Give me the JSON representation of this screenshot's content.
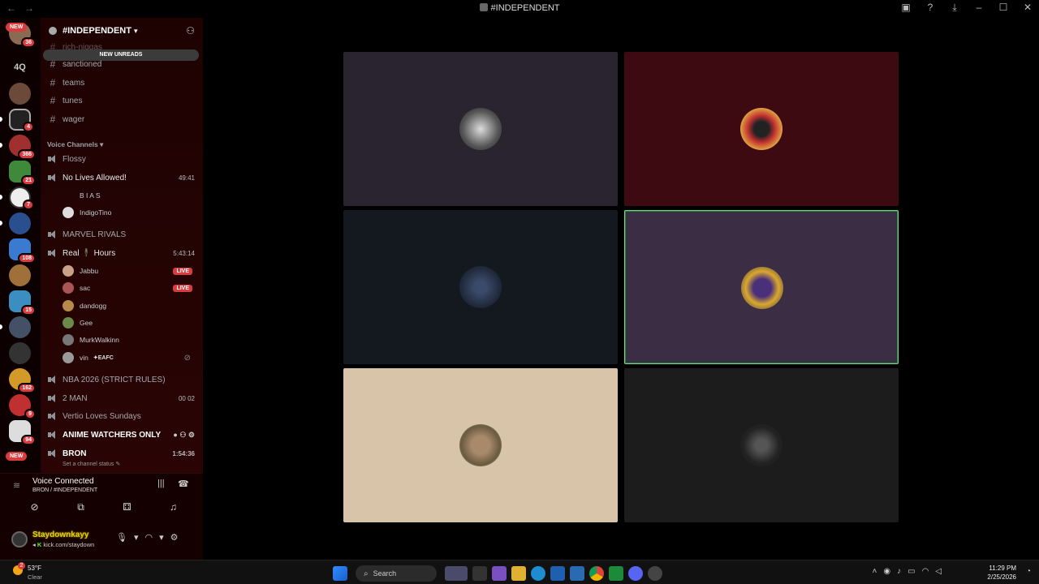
{
  "window": {
    "title": "#INDEPENDENT",
    "controls": [
      "–",
      "☐",
      "✕"
    ]
  },
  "servers": {
    "new_label": "NEW",
    "text_icon": "4Q",
    "badges": [
      "36",
      "4",
      "366",
      "21",
      "7",
      "108",
      "15",
      "162",
      "9",
      "94"
    ]
  },
  "sidebar": {
    "server_name": "#INDEPENDENT",
    "new_unreads": "NEW UNREADS",
    "partial_channel": "rich-niggas",
    "text_channels": [
      "sanctioned",
      "teams",
      "tunes",
      "wager"
    ],
    "voice_category": "Voice Channels",
    "voice": {
      "flossy": "Flossy",
      "no_lives": "No Lives Allowed!",
      "no_lives_time": "49:41",
      "bias": "B I A S",
      "indigo": "IndigoTino",
      "marvel": "MARVEL RIVALS",
      "real_hours": "Real 🕴 Hours",
      "real_hours_time": "5:43:14",
      "users": [
        "Jabbu",
        "sac",
        "dandogg",
        "Gee",
        "MurkWalkinn",
        "vin"
      ],
      "live": "LIVE",
      "vin_tag": "✦EAFC",
      "nba": "NBA 2026 (STRICT RULES)",
      "two_man": "2 MAN",
      "two_man_count": "00  02",
      "vertio": "Vertio Loves Sundays",
      "anime": "ANIME WATCHERS ONLY",
      "bron": "BRON",
      "bron_time": "1:54:36",
      "bron_status": "Set a channel status ✎"
    }
  },
  "voice_panel": {
    "title": "Voice Connected",
    "subtitle": "BRON / #INDEPENDENT"
  },
  "account": {
    "name": "Staydownkayy",
    "sub_prefix": "K",
    "sub": "kick.com/staydown"
  },
  "taskbar": {
    "temp": "53°F",
    "weather": "Clear",
    "weather_badge": "2",
    "search": "Search",
    "time": "11:29 PM",
    "date": "2/25/2026"
  },
  "colors": {
    "active_border": "#6fdc8c",
    "live": "#d83c3e",
    "sidebar_bg": "#1e0202"
  }
}
